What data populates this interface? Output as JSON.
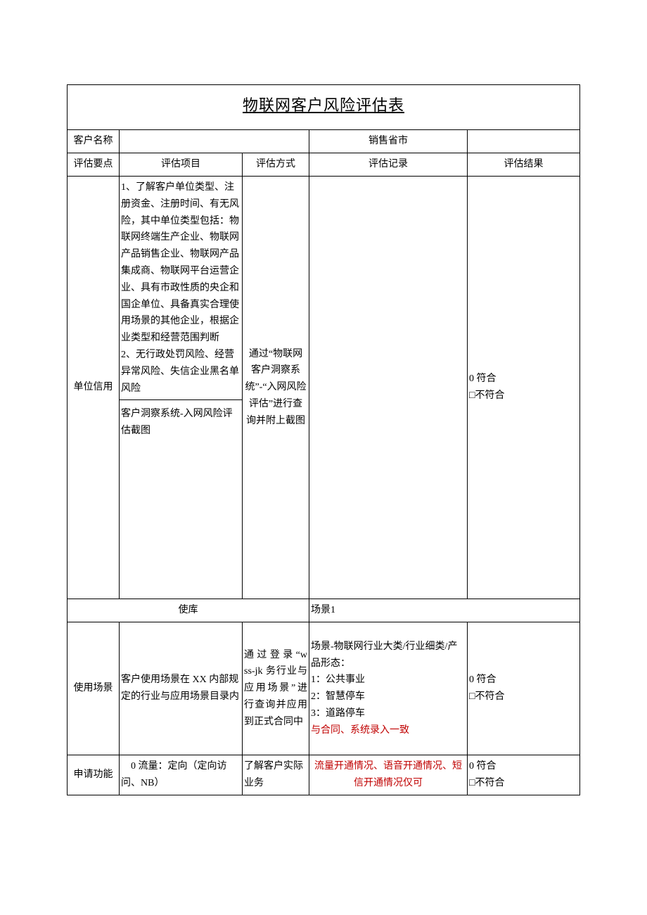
{
  "title": "物联网客户风险评估表",
  "row_customer": {
    "label": "客户名称",
    "value": "",
    "province_label": "销售省市",
    "province_value": ""
  },
  "header": {
    "c1": "评估要点",
    "c2": "评估项目",
    "c3": "评估方式",
    "c4": "评估记录",
    "c5": "评估结果"
  },
  "unit_credit": {
    "label": "单位信用",
    "item1": "1、了解客户单位类型、注册资金、注册时间、有无风险，其中单位类型包括：物联网终端生产企业、物联网产品销售企业、物联网产品集成商、物联网平台运营企业、具有市政性质的央企和国企单位、具备真实合理使用场景的其他企业，根据企业类型和经营范围判断\n2、无行政处罚风险、经营异常风险、失信企业黑名单风险",
    "item2": "客户洞察系统-入网风险评估截图",
    "method": "通过“物联网客户洞察系统”-“入网风险评估”进行查询并附上截图",
    "record": "",
    "result_line1": "0 符合",
    "result_line2": "□不符合"
  },
  "scene_header": {
    "left": "使库",
    "right": "场景1"
  },
  "use_scene": {
    "label": "使用场景",
    "item": "客户使用场景在 XX 内部规定的行业与应用场景目录内",
    "method": "通 过 登 录 “wss-jk  务行业与应用场景”进行查询并应用到正式合同中",
    "record_black": "场景-物联网行业大类/行业细类/产品形态：\n1：公共事业\n2：智慧停车\n3：道路停车",
    "record_red": "与合同、系统录入一致",
    "result_line1": "0 符合",
    "result_line2": "□不符合"
  },
  "apply_func": {
    "label": "申请功能",
    "item": "　0 流量：定向（定向访问、NB）",
    "method": "了解客户实际业务",
    "record_red": "流量开通情况、语音开通情况、短信开通情况仅可",
    "result_line1": "0 符合",
    "result_line2": "□不符合"
  }
}
